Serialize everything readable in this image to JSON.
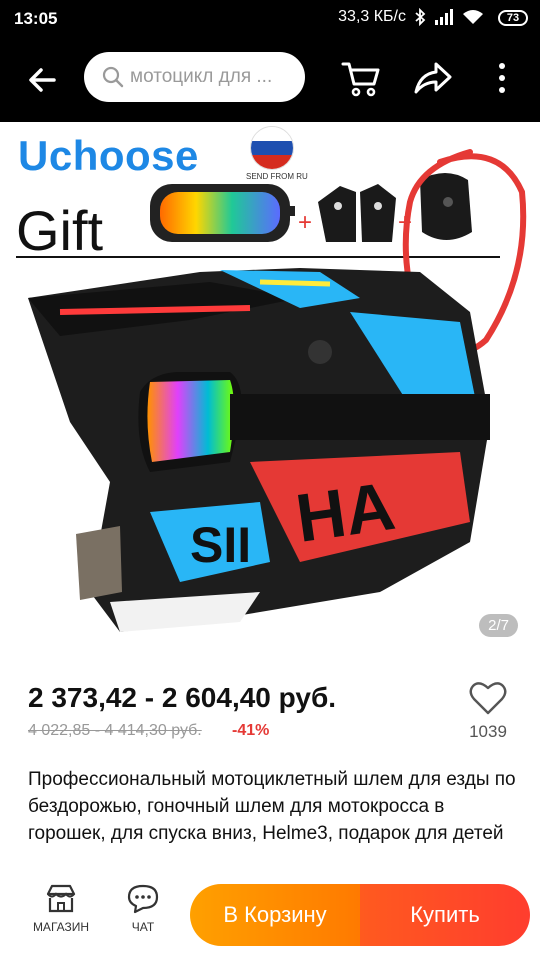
{
  "status_bar": {
    "time": "13:05",
    "network_speed": "33,3 КБ/с",
    "battery": "73",
    "icons": [
      "bluetooth-icon",
      "signal-icon",
      "wifi-icon",
      "battery-icon"
    ]
  },
  "app_bar": {
    "search_placeholder": "мотоцикл для ...",
    "icons": [
      "back-arrow-icon",
      "search-icon",
      "cart-icon",
      "share-icon",
      "more-icon"
    ]
  },
  "gallery": {
    "brand": "Uchoose",
    "send_from": "SEND FROM RU",
    "gift_label": "Gift",
    "plus_sign": "+",
    "page_indicator": "2/7"
  },
  "product": {
    "price": "2 373,42 - 2 604,40 руб.",
    "old_price": "4 022,85 - 4 414,30 руб.",
    "discount": "-41%",
    "favorites_count": "1039",
    "title": "Профессиональный мотоциклетный шлем для езды по бездорожью, гоночный шлем для мотокросса в горошек, для спуска вниз, Helme3, подарок для детей"
  },
  "bottom_bar": {
    "store_label": "МАГАЗИН",
    "chat_label": "ЧАТ",
    "add_to_cart_label": "В Корзину",
    "buy_label": "Купить"
  },
  "colors": {
    "brand_blue": "#1e88e5",
    "cart_button": "#ff8f00",
    "buy_button": "#ff4a26",
    "discount_red": "#e53935",
    "annotation_circle": "#e53935"
  }
}
